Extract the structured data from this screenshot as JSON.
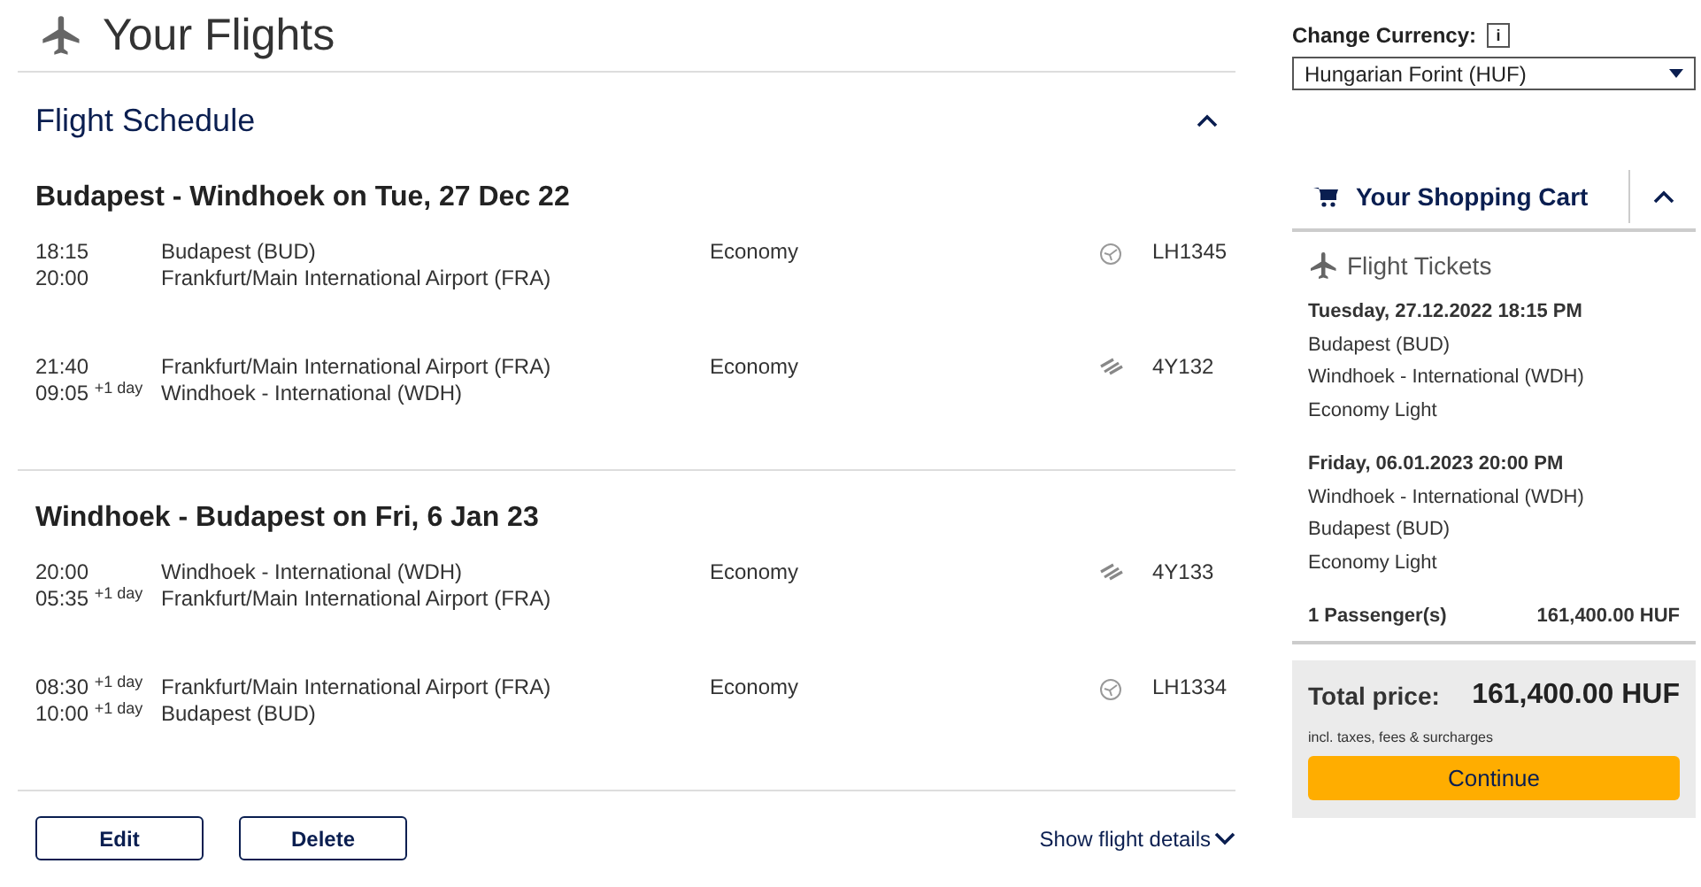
{
  "page_title": "Your Flights",
  "schedule": {
    "title": "Flight Schedule",
    "expanded": true,
    "journeys": [
      {
        "title": "Budapest - Windhoek on Tue, 27 Dec 22",
        "segments": [
          {
            "dep_time": "18:15",
            "arr_time": "20:00",
            "from": "Budapest (BUD)",
            "to": "Frankfurt/Main International Airport (FRA)",
            "cabin": "Economy",
            "kind": "circle",
            "flight": "LH1345"
          },
          {
            "dep_time": "21:40",
            "arr_time": "09:05 $^{+1 day}$",
            "from": "Frankfurt/Main International Airport (FRA)",
            "to": "Windhoek - International (WDH)",
            "cabin": "Economy",
            "kind": "stripes",
            "flight": "4Y132"
          }
        ]
      },
      {
        "title": "Windhoek - Budapest on Fri, 6 Jan 23",
        "segments": [
          {
            "dep_time": "20:00",
            "arr_time": "05:35 $^{+1 day}$",
            "from": "Windhoek - International (WDH)",
            "to": "Frankfurt/Main International Airport (FRA)",
            "cabin": "Economy",
            "kind": "stripes",
            "flight": "4Y133"
          },
          {
            "dep_time": "08:30 $^{+1 day}$",
            "arr_time": "10:00 $^{+1 day}$",
            "from": "Frankfurt/Main International Airport (FRA)",
            "to": "Budapest (BUD)",
            "cabin": "Economy",
            "kind": "circle",
            "flight": "LH1334"
          }
        ]
      }
    ],
    "buttons": [
      "Edit",
      "Delete"
    ],
    "details_link": "Show flight details"
  },
  "currency": {
    "label": "Change Currency:",
    "info": "i",
    "value": "Hungarian Forint (HUF)"
  },
  "cart": {
    "title": "Your Shopping Cart",
    "expanded": true,
    "section": "Flight Tickets",
    "tickets": [
      {
        "date": "Tuesday, 27.12.2022 18:15 PM",
        "lines": [
          "Budapest (BUD)",
          "Windhoek - International (WDH)",
          "Economy Light"
        ]
      },
      {
        "date": "Friday, 06.01.2023 20:00 PM",
        "lines": [
          "Windhoek - International (WDH)",
          "Budapest (BUD)",
          "Economy Light"
        ]
      }
    ],
    "passengers": "1 Passenger(s)",
    "subtotal": "161,400.00 HUF",
    "total_label": "Total price:",
    "total": "161,400.00 HUF",
    "note": "incl. taxes, fees & surcharges",
    "continue": "Continue"
  }
}
